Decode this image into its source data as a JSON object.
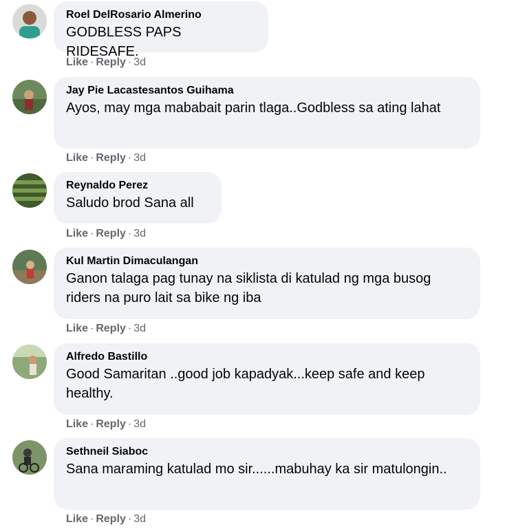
{
  "comments": [
    {
      "author": "Roel DelRosario Almerino",
      "text": "GODBLESS PAPS RIDESAFE.",
      "like": "Like",
      "reply": "Reply",
      "time": "3d",
      "separator": "·",
      "avatar_icon": "profile-photo"
    },
    {
      "author": "Jay Pie Lacastesantos Guihama",
      "text": "Ayos, may mga mababait parin tlaga..Godbless sa ating lahat",
      "like": "Like",
      "reply": "Reply",
      "time": "3d",
      "separator": "·",
      "avatar_icon": "profile-photo"
    },
    {
      "author": "Reynaldo Perez",
      "text": "Saludo brod Sana all",
      "like": "Like",
      "reply": "Reply",
      "time": "3d",
      "separator": "·",
      "avatar_icon": "profile-photo"
    },
    {
      "author": "Kul Martin Dimaculangan",
      "text": "Ganon talaga pag tunay na siklista di katulad ng mga busog riders na puro lait sa bike ng iba",
      "like": "Like",
      "reply": "Reply",
      "time": "3d",
      "separator": "·",
      "avatar_icon": "profile-photo"
    },
    {
      "author": "Alfredo Bastillo",
      "text": "Good Samaritan ..good job kapadyak...keep safe and keep healthy.",
      "like": "Like",
      "reply": "Reply",
      "time": "3d",
      "separator": "·",
      "avatar_icon": "profile-photo"
    },
    {
      "author": "Sethneil Siaboc",
      "text": "Sana maraming katulad mo sir......mabuhay ka sir matulongin..",
      "like": "Like",
      "reply": "Reply",
      "time": "3d",
      "separator": "·",
      "avatar_icon": "profile-photo"
    }
  ],
  "colors": {
    "bubble_bg": "#f0f2f5",
    "text": "#050505",
    "secondary": "#65676b"
  }
}
